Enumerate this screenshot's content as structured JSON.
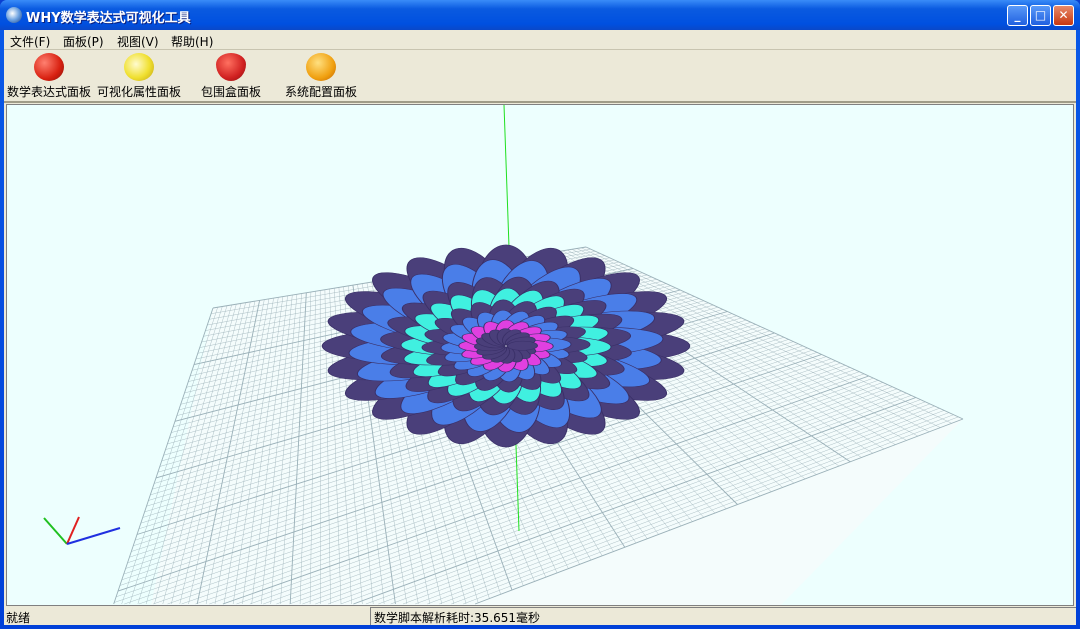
{
  "window": {
    "title": "WHY数学表达式可视化工具",
    "minimize": "_",
    "maximize": "□",
    "close": "✕"
  },
  "menu": [
    {
      "label": "文件(F)"
    },
    {
      "label": "面板(P)"
    },
    {
      "label": "视图(V)"
    },
    {
      "label": "帮助(H)"
    }
  ],
  "toolbar": [
    {
      "label": "数学表达式面板",
      "icon": "tomato-icon",
      "color": "#d82010"
    },
    {
      "label": "可视化属性面板",
      "icon": "lemon-icon",
      "color": "#f0e030"
    },
    {
      "label": "包围盒面板",
      "icon": "strawberry-icon",
      "color": "#d02020"
    },
    {
      "label": "系统配置面板",
      "icon": "orange-icon",
      "color": "#f0a010"
    }
  ],
  "status": {
    "left": "就绪",
    "right": "数学脚本解析耗时:35.651毫秒"
  },
  "colors": {
    "petal_dark": "#4a3f7a",
    "petal_blue": "#4a7ee8",
    "petal_cyan": "#40f0e0",
    "petal_magenta": "#e040e0",
    "grid": "#9ab0b8"
  }
}
